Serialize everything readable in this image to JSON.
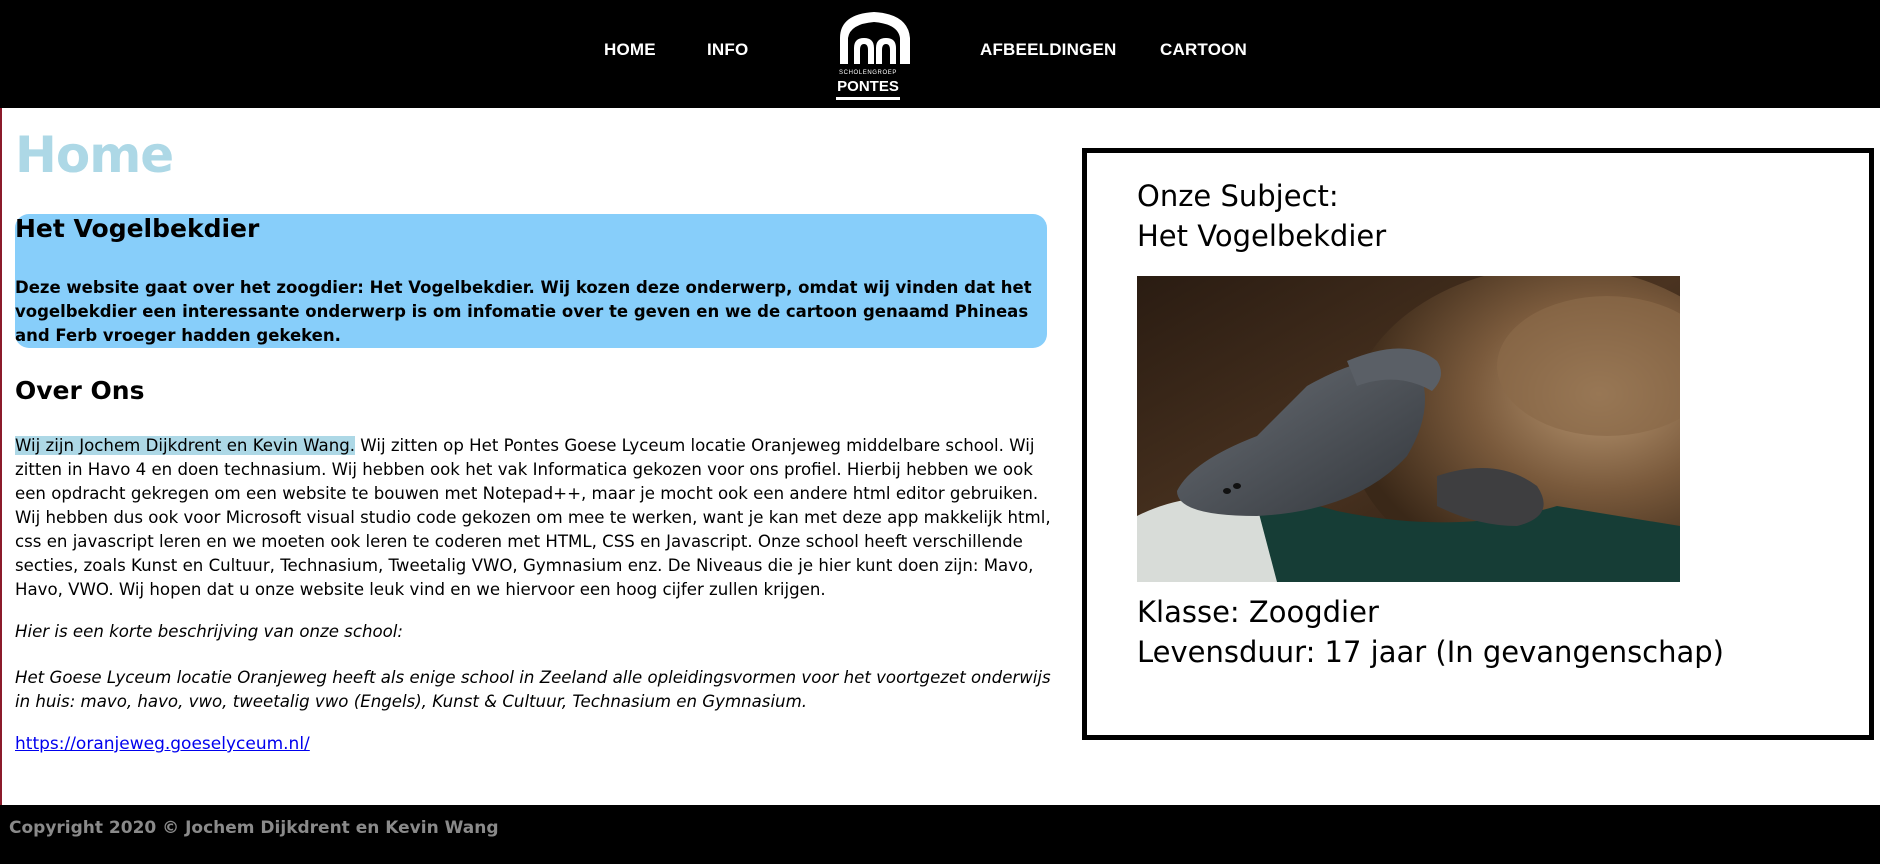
{
  "nav": {
    "items": [
      {
        "label": "HOME"
      },
      {
        "label": "INFO"
      },
      {
        "label": "AFBEELDINGEN"
      },
      {
        "label": "CARTOON"
      }
    ],
    "logo": {
      "subtitle": "SCHOLENGROEP",
      "name": "PONTES"
    }
  },
  "main": {
    "page_title": "Home",
    "intro": {
      "heading": "Het Vogelbekdier",
      "text": "Deze website gaat over het zoogdier: Het Vogelbekdier. Wij kozen deze onderwerp, omdat wij vinden dat het vogelbekdier een interessante onderwerp is om infomatie over te geven en we de cartoon genaamd Phineas and Ferb vroeger hadden gekeken."
    },
    "about": {
      "heading": "Over Ons",
      "highlight": "Wij zijn Jochem Dijkdrent en Kevin Wang.",
      "text": " Wij zitten op Het Pontes Goese Lyceum locatie Oranjeweg middelbare school. Wij zitten in Havo 4 en doen technasium. Wij hebben ook het vak Informatica gekozen voor ons profiel. Hierbij hebben we ook een opdracht gekregen om een website te bouwen met Notepad++, maar je mocht ook een andere html editor gebruiken. Wij hebben dus ook voor Microsoft visual studio code gekozen om mee te werken, want je kan met deze app makkelijk html, css en javascript leren en we moeten ook leren te coderen met HTML, CSS en Javascript. Onze school heeft verschillende secties, zoals Kunst en Cultuur, Technasium, Tweetalig VWO, Gymnasium enz. De Niveaus die je hier kunt doen zijn: Mavo, Havo, VWO. Wij hopen dat u onze website leuk vind en we hiervoor een hoog cijfer zullen krijgen."
    },
    "school": {
      "label": "Hier is een korte beschrijving van onze school:",
      "description": "Het Goese Lyceum locatie Oranjeweg heeft als enige school in Zeeland alle opleidingsvormen voor het voortgezet onderwijs in huis: mavo, havo, vwo, tweetalig vwo (Engels), Kunst & Cultuur, Technasium en Gymnasium.",
      "link": "https://oranjeweg.goeselyceum.nl/"
    }
  },
  "panel": {
    "subject_label": "Onze Subject:",
    "subject_name": "Het Vogelbekdier",
    "image_icon": "platypus-photo",
    "class_line": "Klasse: Zoogdier",
    "life_line": "Levensduur: 17 jaar (In gevangenschap)"
  },
  "footer": {
    "copyright": "Copyright 2020 © Jochem Dijkdrent en Kevin Wang"
  },
  "colors": {
    "nav_bg": "#000000",
    "title": "#add8e6",
    "intro_bg": "#87cefa",
    "highlight": "#add8e6",
    "footer_text": "#8a8a8a",
    "link": "#0000ee"
  }
}
